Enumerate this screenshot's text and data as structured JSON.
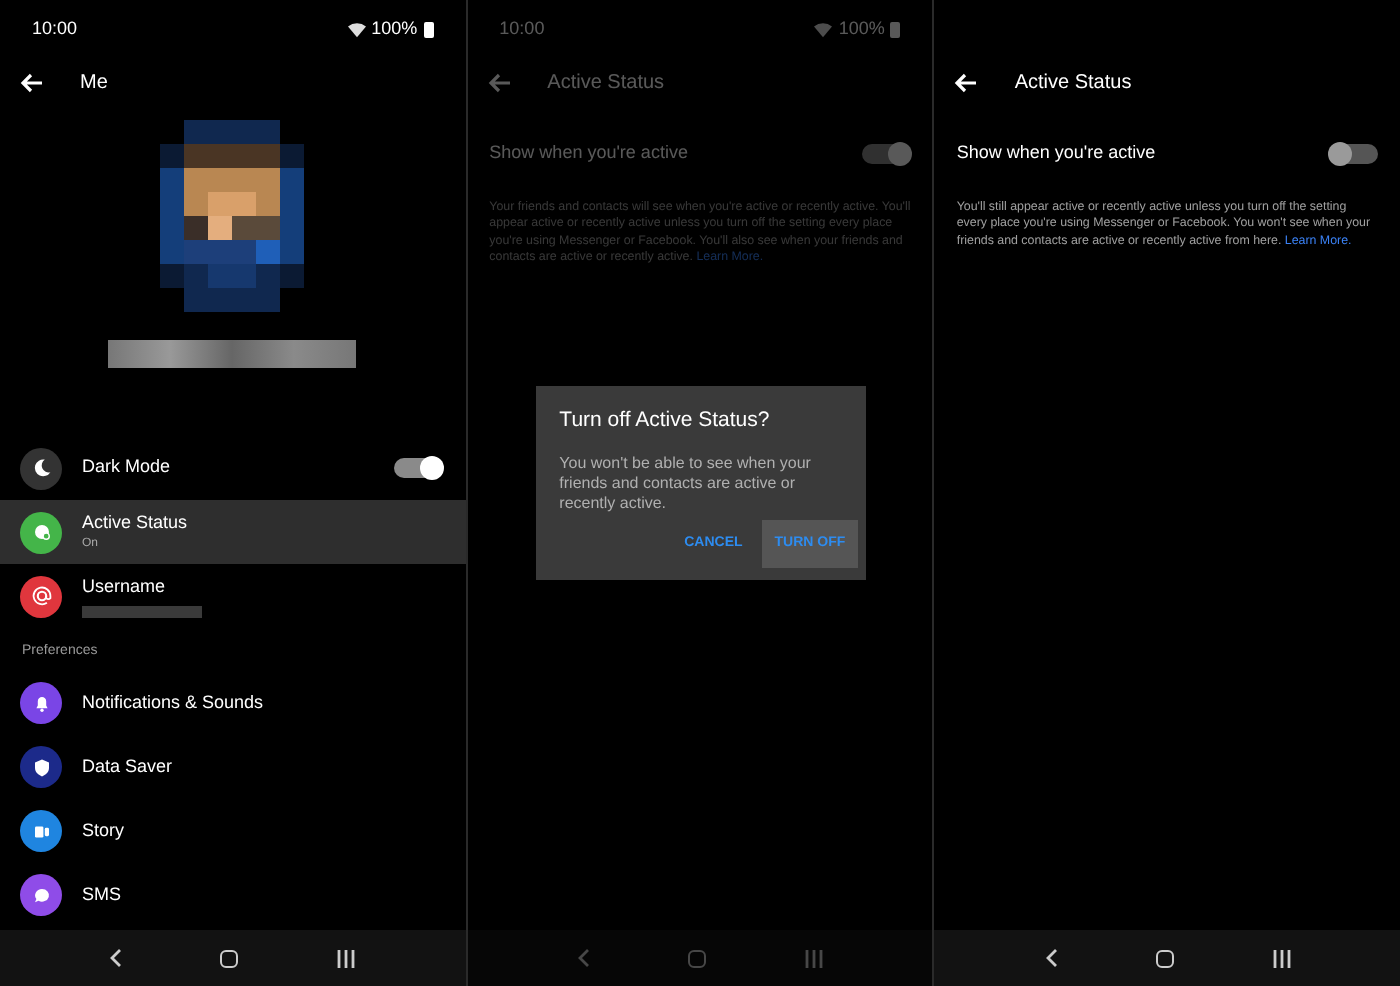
{
  "screens": [
    {
      "kind": "me",
      "status_bar": {
        "time": "10:00",
        "battery": "100%"
      },
      "header": {
        "title": "Me"
      },
      "profile": {
        "avatar": {
          "kind": "picture"
        }
      },
      "items": [
        {
          "kind": "toggle",
          "label": "Dark Mode",
          "color": "#333333",
          "on": true,
          "selected": false
        },
        {
          "kind": "link",
          "label": "Active Status",
          "subtitle": "On",
          "color": "#44b549",
          "selected": true
        },
        {
          "kind": "link",
          "label": "Username",
          "color": "#e0363d",
          "selected": false
        }
      ],
      "section": "Preferences",
      "preferences": [
        {
          "label": "Notifications & Sounds",
          "color": "#7a45e6"
        },
        {
          "label": "Data Saver",
          "color": "#1c2a8a"
        },
        {
          "label": "Story",
          "color": "#1f85e0"
        },
        {
          "label": "SMS",
          "color": "#8f4ce8"
        }
      ]
    },
    {
      "kind": "active_status",
      "dimmed": true,
      "status_bar": {
        "time": "10:00",
        "battery": "100%"
      },
      "header": {
        "title": "Active Status"
      },
      "setting": {
        "label": "Show when you're active",
        "on": true
      },
      "description": "Your friends and contacts will see when you're active or recently active. You'll appear active or recently active unless you turn off the setting every place you're using Messenger or Facebook. You'll also see when your friends and contacts are active or recently active.",
      "link": "Learn More.",
      "dialog": {
        "title": "Turn off Active Status?",
        "message": "You won't be able to see when your friends and contacts are active or recently active.",
        "buttons": [
          {
            "label": "CANCEL",
            "focused": false
          },
          {
            "label": "TURN OFF",
            "focused": true
          }
        ]
      }
    },
    {
      "kind": "active_status",
      "header": {
        "title": "Active Status"
      },
      "setting": {
        "label": "Show when you're active",
        "on": false
      },
      "description": "You'll still appear active or recently active unless you turn off the setting every place you're using Messenger or Facebook. You won't see when your friends and contacts are active or recently active from here.",
      "link": "Learn More."
    }
  ]
}
